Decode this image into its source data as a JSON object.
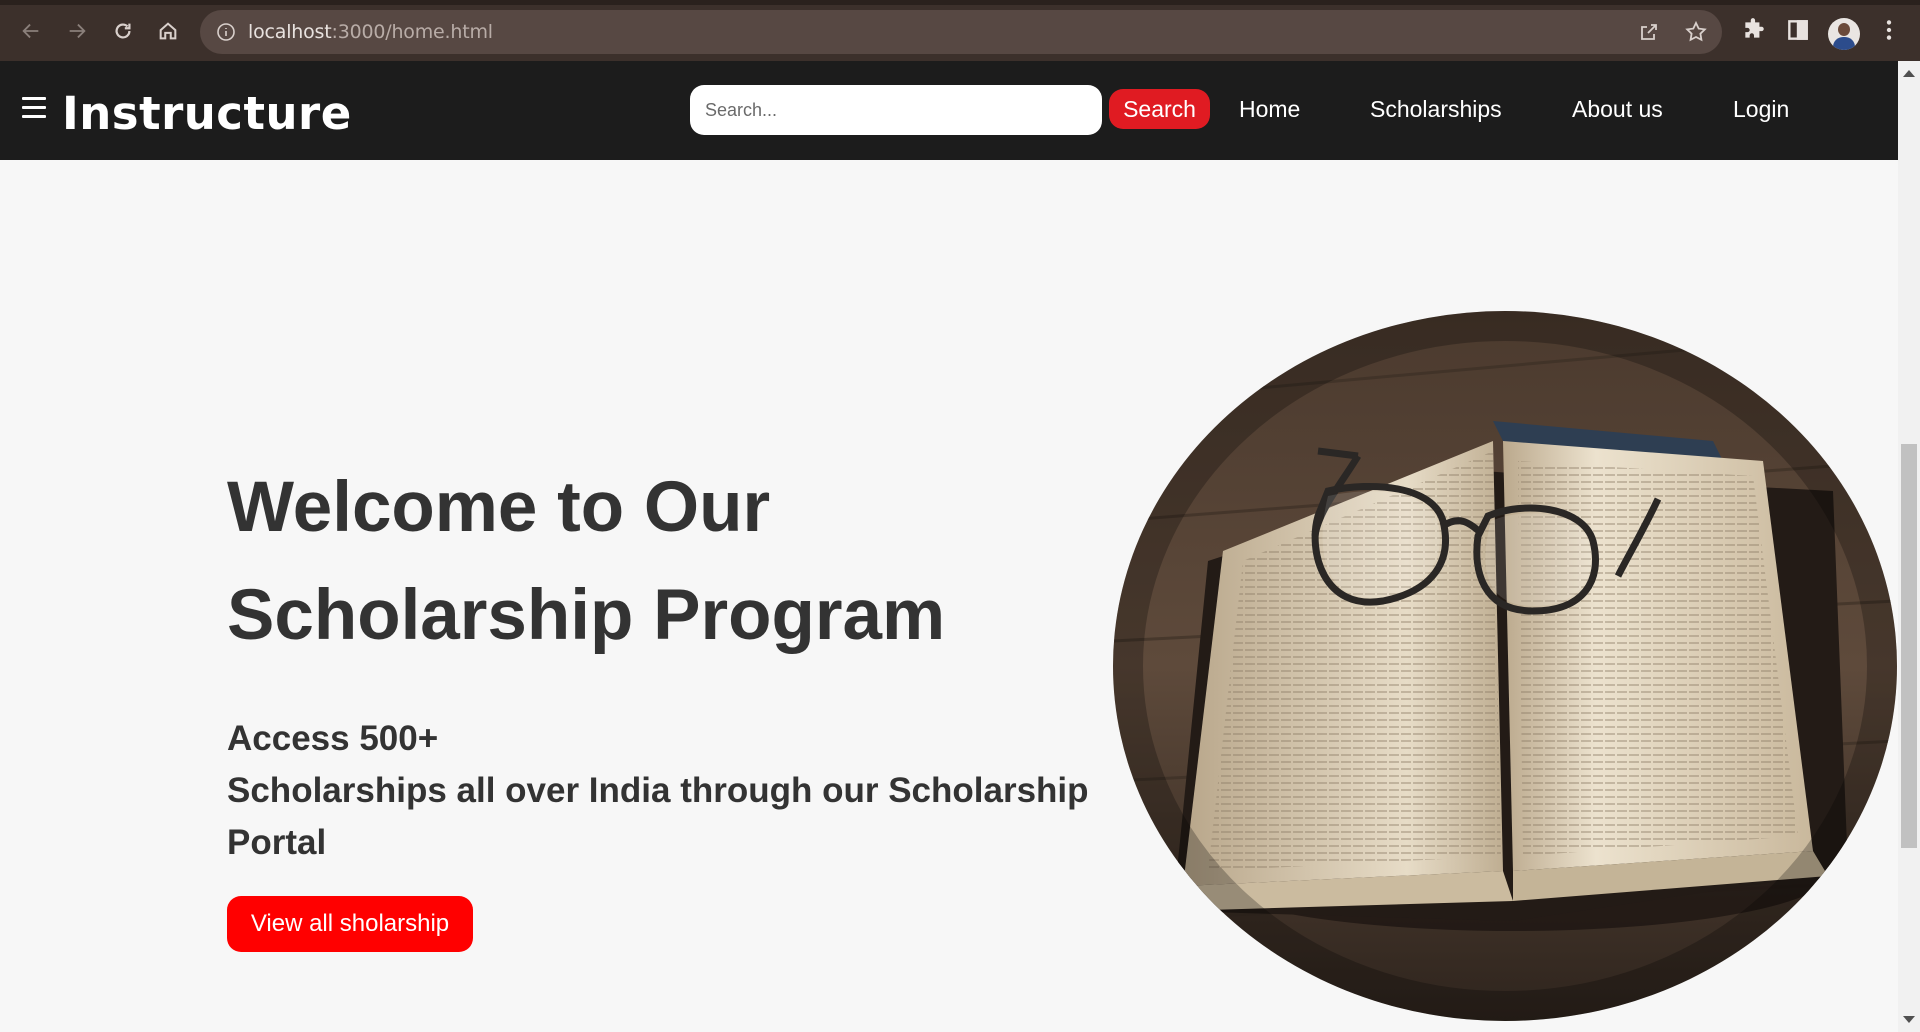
{
  "browser": {
    "url_host": "localhost",
    "url_path": ":3000/home.html",
    "icons": [
      "back-icon",
      "forward-icon",
      "reload-icon",
      "home-icon",
      "site-info-icon",
      "share-icon",
      "bookmark-star-icon",
      "extensions-icon",
      "side-panel-icon",
      "profile-avatar",
      "menu-kebab-icon"
    ]
  },
  "navbar": {
    "brand": "Instructure",
    "search_placeholder": "Search...",
    "search_button": "Search",
    "links": [
      "Home",
      "Scholarships",
      "About us",
      "Login"
    ]
  },
  "hero": {
    "title_line1": "Welcome to Our",
    "title_line2": "Scholarship Program",
    "subtitle_line1": "Access 500+",
    "subtitle_line2": "Scholarships all over India through our Scholarship",
    "subtitle_line3": "Portal",
    "cta": "View all sholarship",
    "image_subject": "open-book-with-eyeglasses"
  },
  "colors": {
    "navbar_bg": "#1c1c1c",
    "accent_red": "#ff0000",
    "search_red": "#e01b22",
    "page_bg": "#f7f7f7",
    "text_dark": "#333333"
  }
}
